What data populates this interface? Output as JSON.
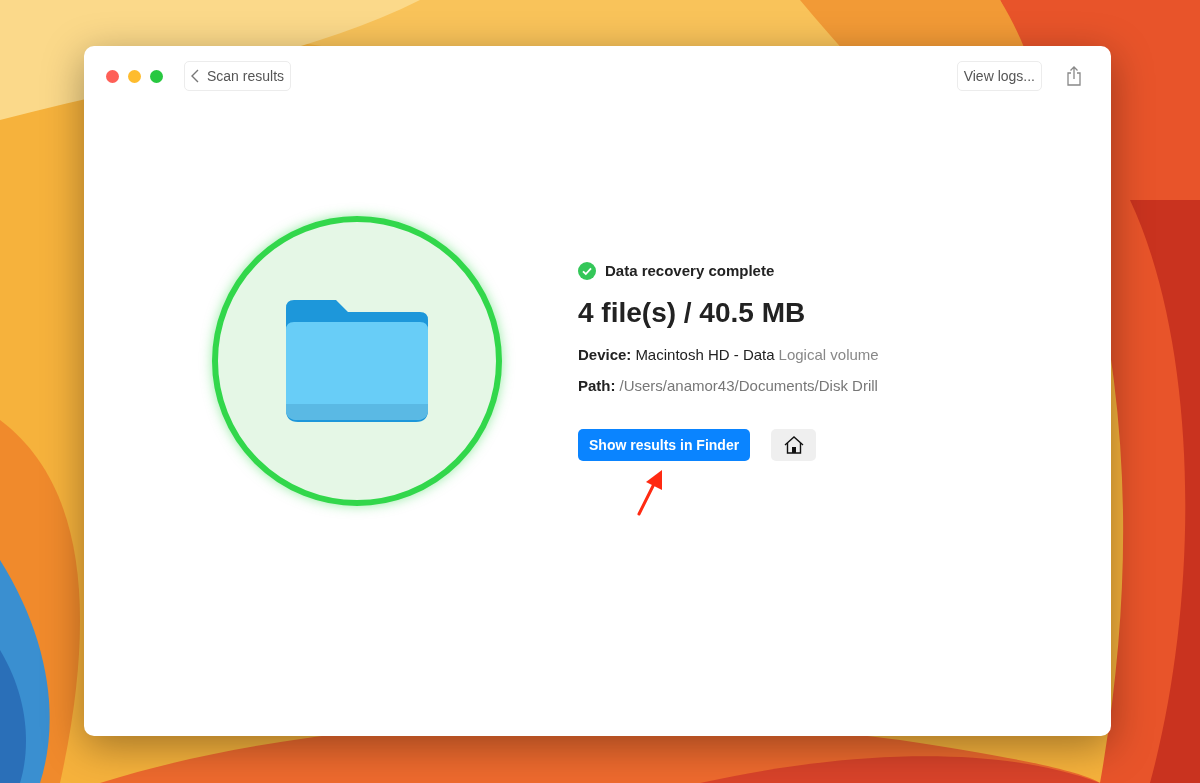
{
  "window": {
    "back_button": "Scan results",
    "view_logs_button": "View logs..."
  },
  "status": {
    "text": "Data recovery complete"
  },
  "summary": "4 file(s) / 40.5 MB",
  "details": [
    {
      "label": "Device:",
      "value": "Macintosh HD - Data",
      "muted": false,
      "note": "Logical volume"
    },
    {
      "label": "Path:",
      "value": "/Users/anamor43/Documents/Disk Drill",
      "muted": true
    }
  ],
  "primary_button": "Show results in Finder"
}
